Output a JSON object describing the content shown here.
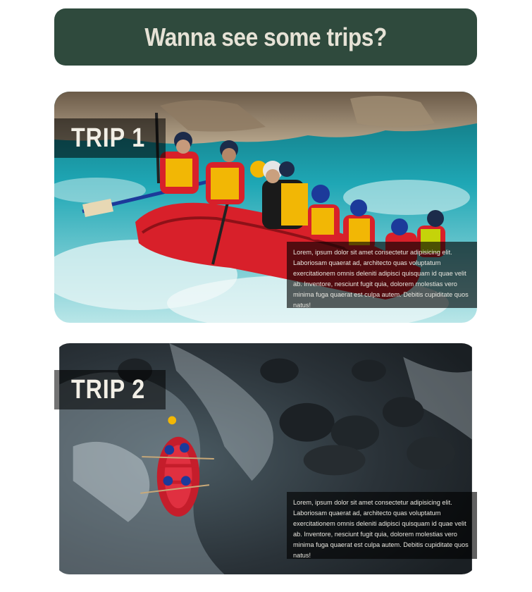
{
  "header": {
    "title": "Wanna see some trips?"
  },
  "trips": [
    {
      "label": "TRIP 1",
      "description": "Lorem, ipsum dolor sit amet consectetur adipisicing elit. Laboriosam quaerat ad, architecto quas voluptatum exercitationem omnis deleniti adipisci quisquam id quae velit ab. Inventore, nesciunt fugit quia, dolorem molestias vero minima fuga quaerat est culpa autem. Debitis cupiditate quos natus!",
      "image": "whitewater-rafting-crew-photo"
    },
    {
      "label": "TRIP 2",
      "description": "Lorem, ipsum dolor sit amet consectetur adipisicing elit. Laboriosam quaerat ad, architecto quas voluptatum exercitationem omnis deleniti adipisci quisquam id quae velit ab. Inventore, nesciunt fugit quia, dolorem molestias vero minima fuga quaerat est culpa autem. Debitis cupiditate quos natus!",
      "image": "aerial-rafting-photo"
    }
  ],
  "colors": {
    "header_bg": "#2f4a3d",
    "header_text": "#e6e2d6",
    "raft_red": "#d8202a",
    "water_teal": "#1fa7b5"
  }
}
